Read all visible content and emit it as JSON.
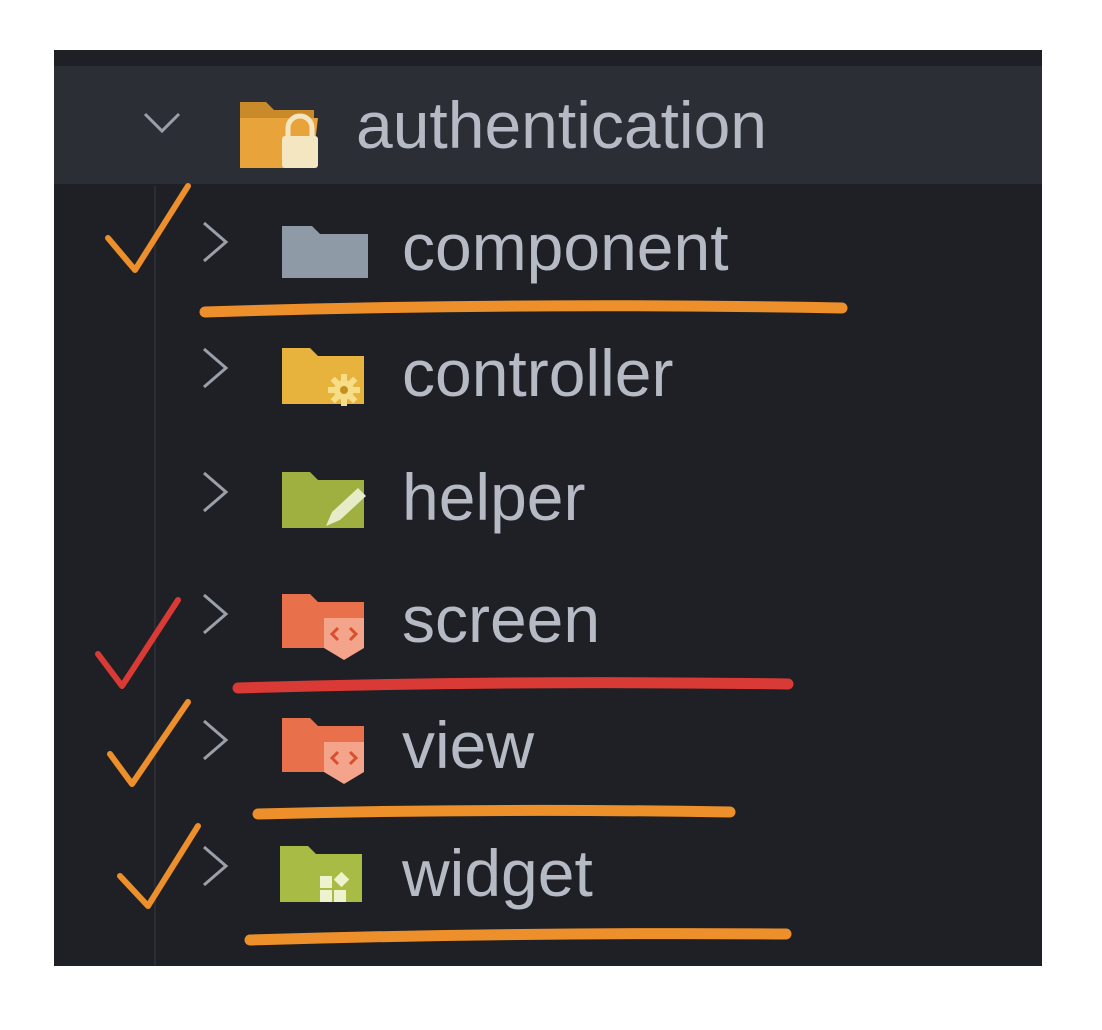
{
  "explorer": {
    "root": {
      "label": "authentication",
      "icon": "folder-open-lock-icon",
      "expanded": true
    },
    "items": [
      {
        "label": "component",
        "icon": "folder-plain-icon",
        "color": "#8e9aa6",
        "expanded": false
      },
      {
        "label": "controller",
        "icon": "folder-gear-icon",
        "color": "#e8b33c",
        "expanded": false
      },
      {
        "label": "helper",
        "icon": "folder-pencil-icon",
        "color": "#9fb040",
        "expanded": false
      },
      {
        "label": "screen",
        "icon": "folder-code-icon",
        "color": "#e8714b",
        "expanded": false
      },
      {
        "label": "view",
        "icon": "folder-code-icon",
        "color": "#e8714b",
        "expanded": false
      },
      {
        "label": "widget",
        "icon": "folder-widget-icon",
        "color": "#a7bb45",
        "expanded": false
      }
    ]
  },
  "annotations": {
    "orange": "#ed8f2a",
    "red": "#d93a35"
  }
}
